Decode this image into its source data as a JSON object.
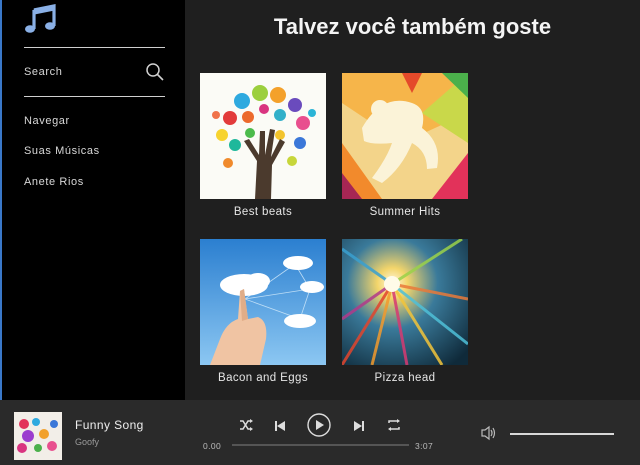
{
  "sidebar": {
    "search_label": "Search",
    "nav_items": [
      {
        "label": "Navegar"
      },
      {
        "label": "Suas Músicas"
      },
      {
        "label": "Anete Rios"
      }
    ]
  },
  "main": {
    "title": "Talvez você também goste",
    "cards": [
      {
        "label": "Best beats"
      },
      {
        "label": "Summer Hits"
      },
      {
        "label": "Bacon and Eggs"
      },
      {
        "label": "Pizza head"
      }
    ]
  },
  "player": {
    "song_title": "Funny Song",
    "artist": "Goofy",
    "time_current": "0.00",
    "time_total": "3:07",
    "progress": 0.0,
    "volume": 1.0
  },
  "colors": {
    "sidebar_bg": "#000000",
    "main_bg": "#1f1f1f",
    "player_bg": "#2a2a2a",
    "accent_logo": "#8ab0e6"
  },
  "icons": [
    "music-note-icon",
    "search-icon",
    "shuffle-icon",
    "previous-icon",
    "play-icon",
    "next-icon",
    "repeat-icon",
    "volume-icon"
  ]
}
